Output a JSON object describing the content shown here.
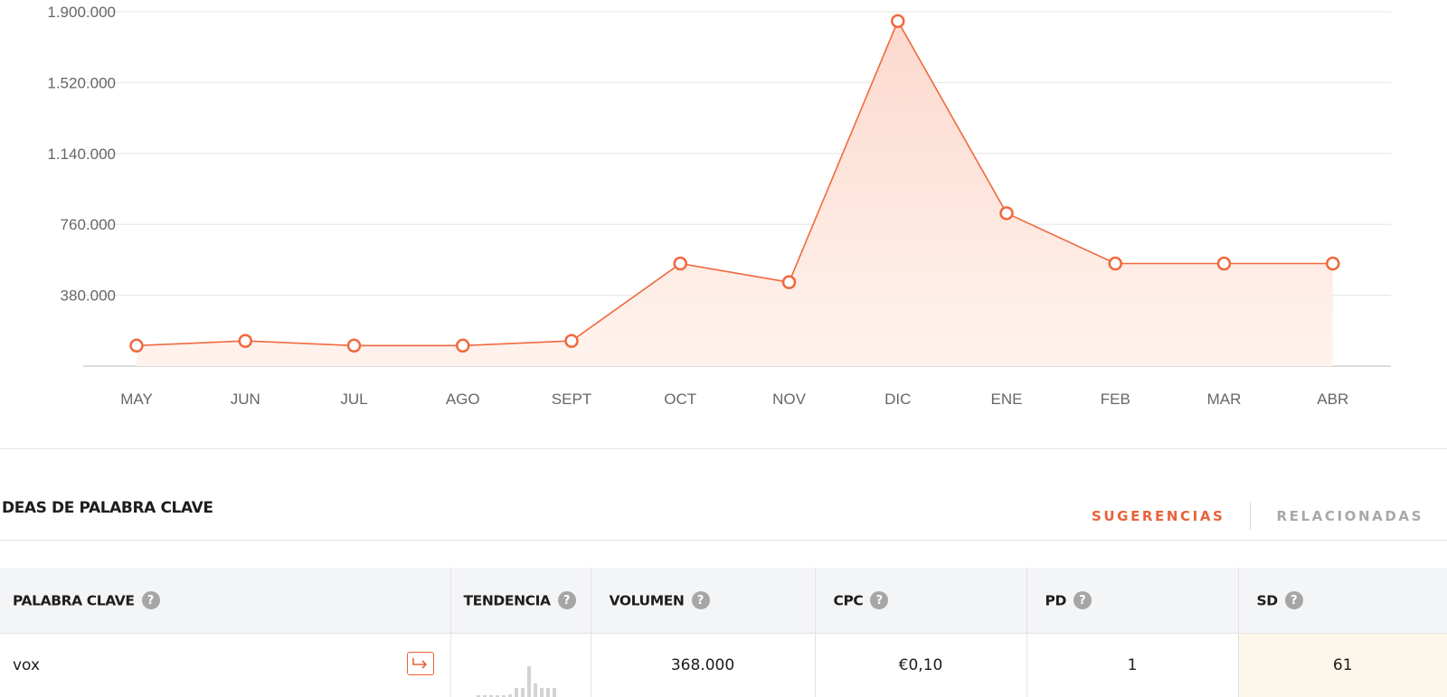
{
  "chart_data": {
    "type": "area",
    "categories": [
      "MAY",
      "JUN",
      "JUL",
      "AGO",
      "SEPT",
      "OCT",
      "NOV",
      "DIC",
      "ENE",
      "FEB",
      "MAR",
      "ABR"
    ],
    "values": [
      110000,
      135000,
      110000,
      110000,
      135000,
      550000,
      450000,
      1850000,
      820000,
      550000,
      550000,
      550000
    ],
    "yticks": [
      "380.000",
      "760.000",
      "1.140.000",
      "1.520.000",
      "1.900.000"
    ],
    "ylim": [
      0,
      1900000
    ],
    "grid": true,
    "colors": {
      "line": "#f0693e",
      "fill_top": "#fcd9cd",
      "fill_bottom": "#fff3ee"
    }
  },
  "section": {
    "title": "DEAS DE PALABRA CLAVE"
  },
  "tabs": [
    {
      "label": "SUGERENCIAS",
      "active": true
    },
    {
      "label": "RELACIONADAS",
      "active": false
    }
  ],
  "table": {
    "columns": {
      "keyword": "PALABRA CLAVE",
      "trend": "TENDENCIA",
      "volume": "VOLUMEN",
      "cpc": "CPC",
      "pd": "PD",
      "sd": "SD"
    },
    "help_glyph": "?",
    "rows": [
      {
        "keyword": "vox",
        "trend_bars": [
          0.05,
          0.05,
          0.05,
          0.05,
          0.05,
          0.1,
          0.3,
          0.3,
          1.0,
          0.45,
          0.3,
          0.3,
          0.3
        ],
        "volume": "368.000",
        "cpc": "€0,10",
        "pd": "1",
        "sd": "61"
      }
    ]
  },
  "icons": {
    "help": "help-circle-icon",
    "go": "arrow-right-into-icon"
  },
  "colors": {
    "accent": "#e8633a",
    "muted": "#a8a8a8",
    "header_bg": "#f4f5f7",
    "sd_bg": "#fdf6ea"
  }
}
